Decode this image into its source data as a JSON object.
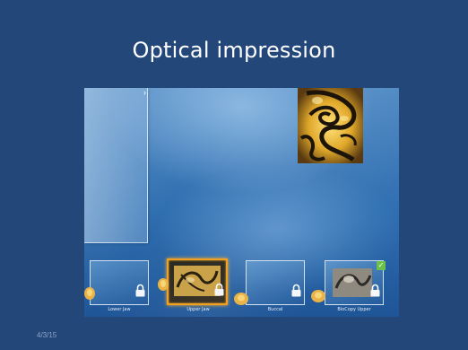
{
  "slide": {
    "title": "Optical impression",
    "date": "4/3/15"
  },
  "screen": {
    "thumbnails": [
      {
        "label": "Lower Jaw",
        "state": "locked"
      },
      {
        "label": "Upper Jaw",
        "state": "selected"
      },
      {
        "label": "Buccal",
        "state": "locked"
      },
      {
        "label": "BioCopy Upper",
        "state": "scanned"
      }
    ],
    "icons": {
      "lock": "lock-icon",
      "check": "check-icon",
      "panel_handle": "chevron-right-icon"
    },
    "colors": {
      "slide_background": "#24477a",
      "selected_border": "#f1a020",
      "check": "#6ac04a"
    }
  }
}
